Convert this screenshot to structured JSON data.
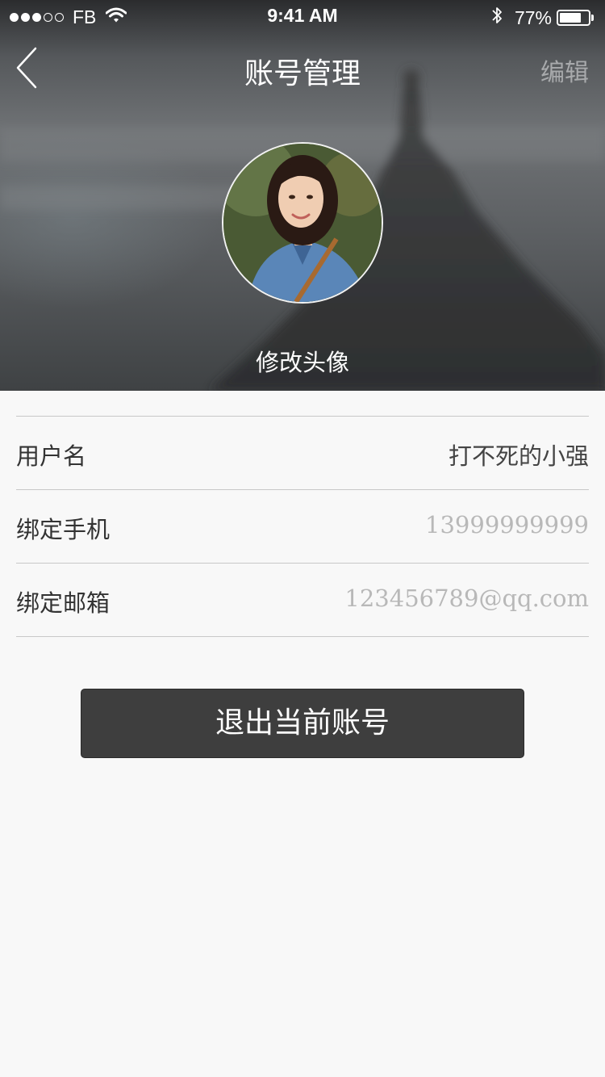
{
  "status_bar": {
    "carrier": "FB",
    "time": "9:41 AM",
    "battery": "77%",
    "battery_level": 0.77,
    "icons": [
      "signal-dots-icon",
      "wifi-icon",
      "bluetooth-icon",
      "battery-icon"
    ]
  },
  "nav": {
    "title": "账号管理",
    "edit_label": "编辑",
    "back_icon": "chevron-left-icon"
  },
  "profile": {
    "change_avatar_label": "修改头像"
  },
  "fields": [
    {
      "label": "用户名",
      "value": "打不死的小强"
    },
    {
      "label": "绑定手机",
      "value": "13999999999"
    },
    {
      "label": "绑定邮箱",
      "value": "123456789@qq.com"
    }
  ],
  "logout_label": "退出当前账号",
  "colors": {
    "page_background": "#f8f8f8",
    "button_background": "#3e3e3e",
    "divider": "#c8c8c8",
    "muted_text": "#b8b8b8"
  }
}
